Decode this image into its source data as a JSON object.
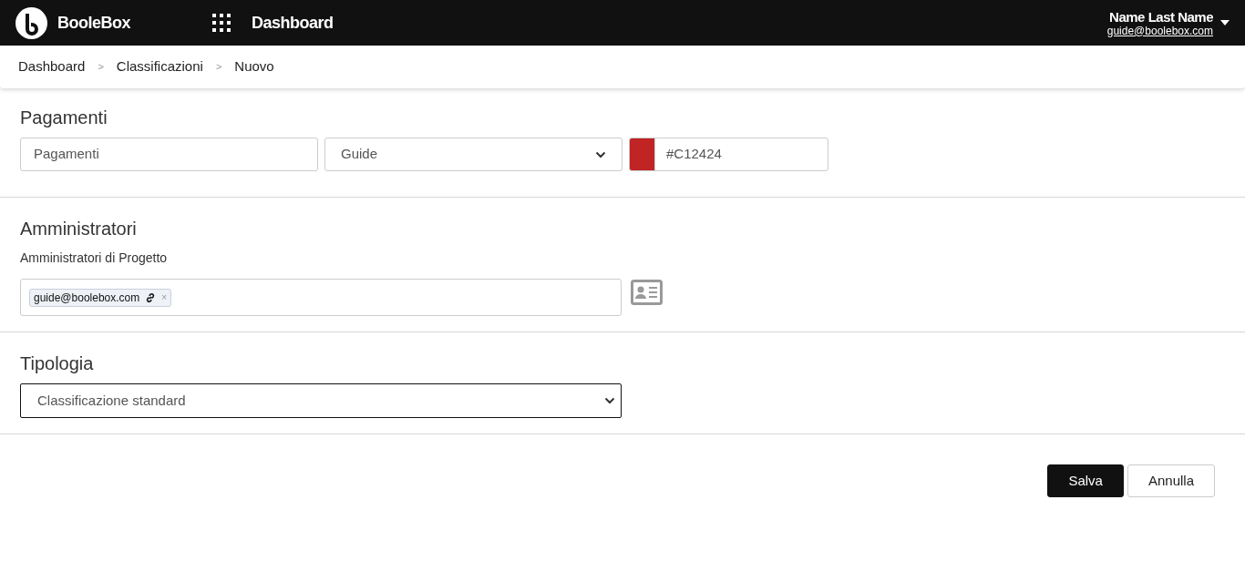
{
  "header": {
    "brand": "BooleBox",
    "page_title": "Dashboard",
    "user": {
      "name": "Name Last Name",
      "email": "guide@boolebox.com"
    }
  },
  "breadcrumb": [
    {
      "label": "Dashboard"
    },
    {
      "label": "Classificazioni"
    },
    {
      "label": "Nuovo"
    }
  ],
  "breadcrumb_separator": ">",
  "sections": [
    {
      "kind": "details",
      "title": "Pagamenti",
      "name_value": "Pagamenti",
      "category": "Guide",
      "color_value": "#C12424"
    },
    {
      "kind": "admins",
      "title": "Amministratori",
      "label": "Amministratori di Progetto",
      "tags": [
        {
          "label": "guide@boolebox.com",
          "remove": "×"
        }
      ]
    },
    {
      "kind": "type",
      "title": "Tipologia",
      "value": "Classificazione standard",
      "focused": true
    }
  ],
  "buttons": [
    {
      "label": "Salva",
      "primary": true
    },
    {
      "label": "Annulla",
      "primary": false
    }
  ]
}
